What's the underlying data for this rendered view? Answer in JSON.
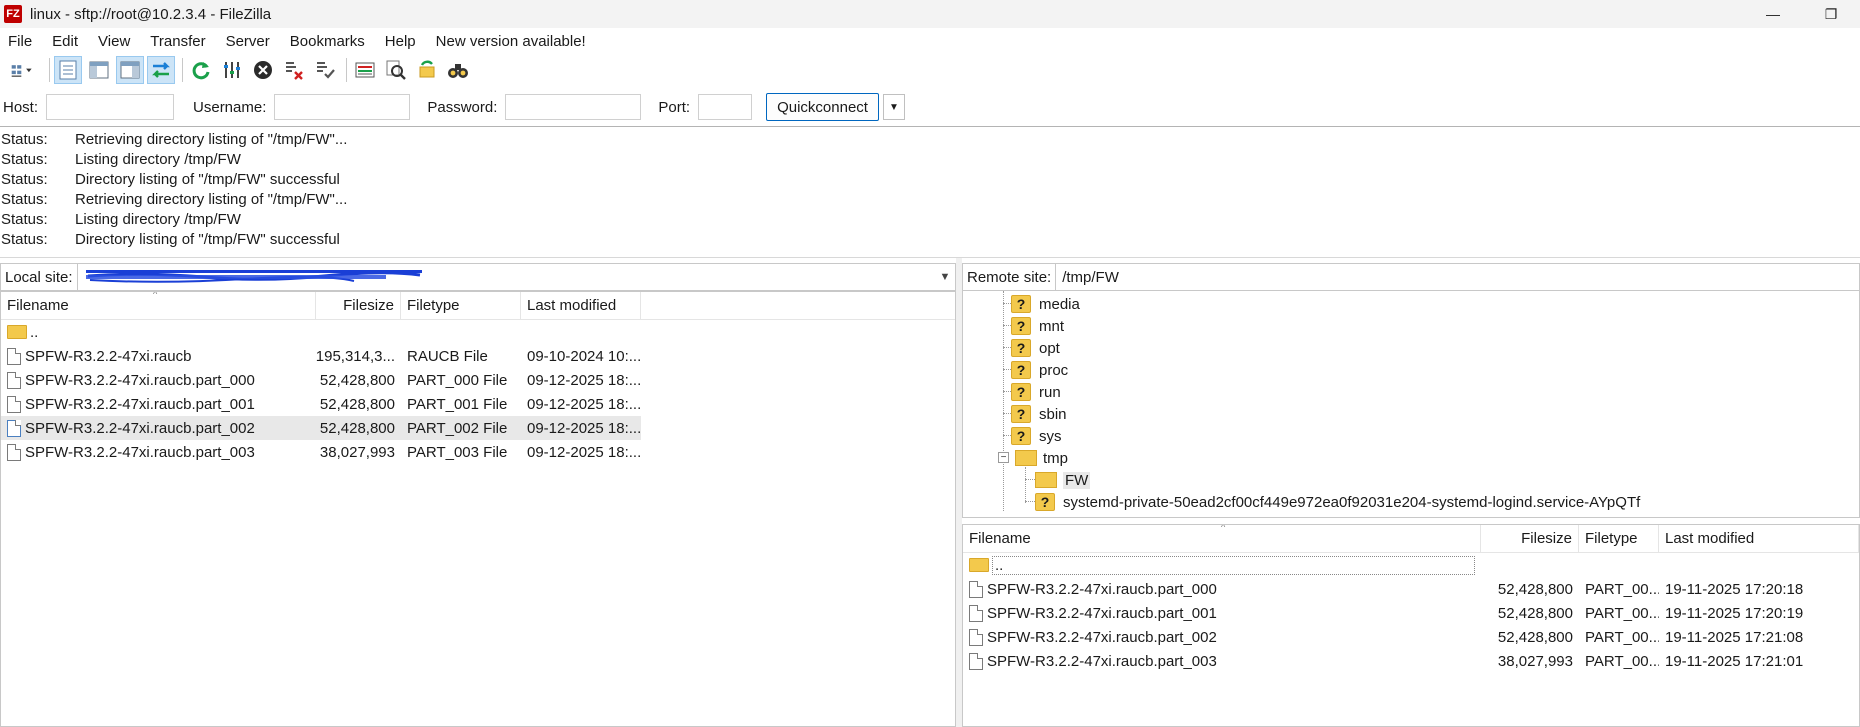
{
  "window": {
    "app_icon": "FZ",
    "title": "linux - sftp://root@10.2.3.4 - FileZilla",
    "minimize_glyph": "—",
    "restore_glyph": "❐"
  },
  "menu": [
    "File",
    "Edit",
    "View",
    "Transfer",
    "Server",
    "Bookmarks",
    "Help",
    "New version available!"
  ],
  "toolbar": {
    "icons": [
      "site-manager-icon",
      "toggle-log-icon",
      "toggle-local-tree-icon",
      "toggle-remote-tree-icon",
      "toggle-queue-icon",
      "refresh-icon",
      "filter-icon",
      "cancel-icon",
      "disconnect-icon",
      "reconnect-icon",
      "compare-icon",
      "sync-browse-icon",
      "search-icon",
      "binoculars-icon"
    ]
  },
  "quickconnect": {
    "host_label": "Host:",
    "host_value": "",
    "username_label": "Username:",
    "username_value": "",
    "password_label": "Password:",
    "password_value": "",
    "port_label": "Port:",
    "port_value": "",
    "button_label": "Quickconnect",
    "dropdown_glyph": "▼"
  },
  "log": [
    {
      "type": "Status:",
      "message": "Retrieving directory listing of \"/tmp/FW\"..."
    },
    {
      "type": "Status:",
      "message": "Listing directory /tmp/FW"
    },
    {
      "type": "Status:",
      "message": "Directory listing of \"/tmp/FW\" successful"
    },
    {
      "type": "Status:",
      "message": "Retrieving directory listing of \"/tmp/FW\"..."
    },
    {
      "type": "Status:",
      "message": "Listing directory /tmp/FW"
    },
    {
      "type": "Status:",
      "message": "Directory listing of \"/tmp/FW\" successful"
    }
  ],
  "local": {
    "site_label": "Local site:",
    "columns": {
      "filename": "Filename",
      "filesize": "Filesize",
      "filetype": "Filetype",
      "modified": "Last modified"
    },
    "parent": "..",
    "files": [
      {
        "name": "SPFW-R3.2.2-47xi.raucb",
        "size": "195,314,3...",
        "type": "RAUCB File",
        "modified": "09-10-2024 10:..."
      },
      {
        "name": "SPFW-R3.2.2-47xi.raucb.part_000",
        "size": "52,428,800",
        "type": "PART_000 File",
        "modified": "09-12-2025 18:..."
      },
      {
        "name": "SPFW-R3.2.2-47xi.raucb.part_001",
        "size": "52,428,800",
        "type": "PART_001 File",
        "modified": "09-12-2025 18:..."
      },
      {
        "name": "SPFW-R3.2.2-47xi.raucb.part_002",
        "size": "52,428,800",
        "type": "PART_002 File",
        "modified": "09-12-2025 18:..."
      },
      {
        "name": "SPFW-R3.2.2-47xi.raucb.part_003",
        "size": "38,027,993",
        "type": "PART_003 File",
        "modified": "09-12-2025 18:..."
      }
    ]
  },
  "remote": {
    "site_label": "Remote site:",
    "path": "/tmp/FW",
    "tree": {
      "unknown_dirs": [
        "media",
        "mnt",
        "opt",
        "proc",
        "run",
        "sbin",
        "sys"
      ],
      "tmp": "tmp",
      "expander_glyph": "−",
      "q_glyph": "?",
      "fw": "FW",
      "systemd": "systemd-private-50ead2cf00cf449e972ea0f92031e204-systemd-logind.service-AYpQTf"
    },
    "columns": {
      "filename": "Filename",
      "filesize": "Filesize",
      "filetype": "Filetype",
      "modified": "Last modified"
    },
    "parent": "..",
    "files": [
      {
        "name": "SPFW-R3.2.2-47xi.raucb.part_000",
        "size": "52,428,800",
        "type": "PART_00...",
        "modified": "19-11-2025 17:20:18"
      },
      {
        "name": "SPFW-R3.2.2-47xi.raucb.part_001",
        "size": "52,428,800",
        "type": "PART_00...",
        "modified": "19-11-2025 17:20:19"
      },
      {
        "name": "SPFW-R3.2.2-47xi.raucb.part_002",
        "size": "52,428,800",
        "type": "PART_00...",
        "modified": "19-11-2025 17:21:08"
      },
      {
        "name": "SPFW-R3.2.2-47xi.raucb.part_003",
        "size": "38,027,993",
        "type": "PART_00...",
        "modified": "19-11-2025 17:21:01"
      }
    ]
  },
  "colors": {
    "accent": "#0067c0",
    "folder": "#f3c94c",
    "selection": "#e8e8e8",
    "redaction": "#1a3fd6"
  }
}
